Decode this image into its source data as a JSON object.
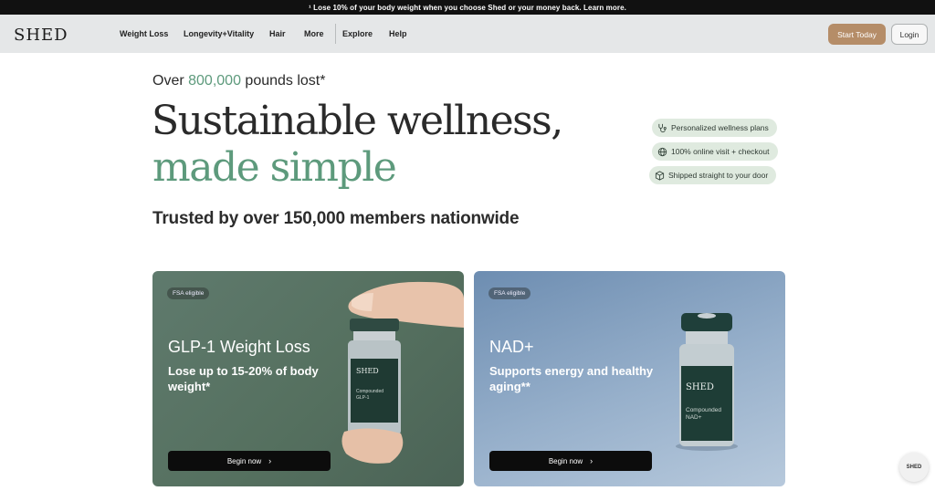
{
  "promo": {
    "text": "¹ Lose 10% of your body weight when you choose Shed or your money back. Learn more."
  },
  "header": {
    "logo": "SHED",
    "nav": [
      "Weight Loss",
      "Longevity+Vitality",
      "Hair",
      "More",
      "Explore",
      "Help"
    ],
    "start_label": "Start Today",
    "login_label": "Login"
  },
  "hero": {
    "stat_prefix": "Over ",
    "stat_value": "800,000",
    "stat_suffix": " pounds lost*",
    "headline": "Sustainable wellness,",
    "headline_accent": "made simple",
    "trusted": "Trusted by over 150,000 members nationwide"
  },
  "features": [
    {
      "icon": "stethoscope-icon",
      "label": "Personalized wellness plans"
    },
    {
      "icon": "globe-icon",
      "label": "100% online visit + checkout"
    },
    {
      "icon": "box-icon",
      "label": "Shipped straight to your door"
    }
  ],
  "cards": [
    {
      "badge": "FSA eligible",
      "title": "GLP-1 Weight Loss",
      "subtitle": "Lose up to 15-20% of body weight*",
      "button": "Begin now",
      "vial_brand": "SHED",
      "vial_line1": "Compounded",
      "vial_line2": "GLP-1"
    },
    {
      "badge": "FSA eligible",
      "title": "NAD+",
      "subtitle": "Supports energy and healthy aging**",
      "button": "Begin now",
      "vial_brand": "SHED",
      "vial_line1": "Compounded",
      "vial_line2": "NAD+"
    }
  ],
  "chat": {
    "label": "SHED"
  },
  "colors": {
    "accent_green": "#5d9a7c",
    "start_button": "#b58d68",
    "pill_bg": "#dfeadf"
  }
}
